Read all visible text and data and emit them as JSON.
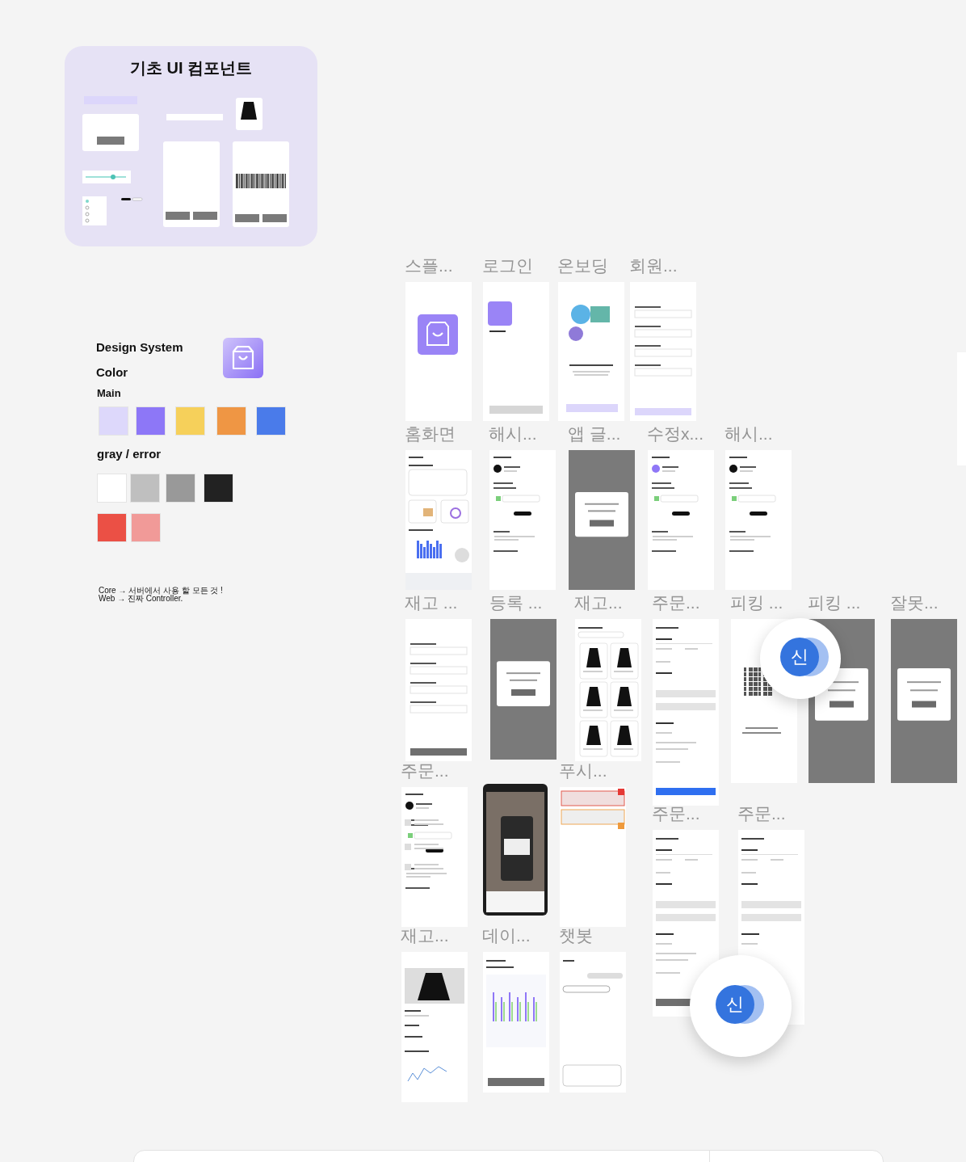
{
  "components_board": {
    "title": "기초 UI 컴포넌트"
  },
  "design_system": {
    "title": "Design System",
    "color_heading": "Color",
    "main_label": "Main",
    "main_colors": [
      {
        "color": "#ddd8fb"
      },
      {
        "color": "#8d77f7"
      },
      {
        "color": "#f6d05a"
      },
      {
        "color": "#ef9644"
      },
      {
        "color": "#4a7bea"
      }
    ],
    "gray_label": "gray / error",
    "gray_colors": [
      {
        "color": "#ffffff"
      },
      {
        "color": "#bfbfbf"
      },
      {
        "color": "#999999"
      },
      {
        "color": "#222222"
      }
    ],
    "error_colors": [
      {
        "color": "#eb5045"
      },
      {
        "color": "#f19a98"
      }
    ],
    "notes": [
      "Core → 서버에서 사용 할 모든 것 !",
      "Web → 진짜 Controller."
    ]
  },
  "frames": [
    {
      "title": "스플...",
      "kind": "splash"
    },
    {
      "title": "로그인",
      "kind": "login"
    },
    {
      "title": "온보딩",
      "kind": "onboarding"
    },
    {
      "title": "회원...",
      "kind": "form"
    },
    {
      "title": "홈화면",
      "kind": "home"
    },
    {
      "title": "해시...",
      "kind": "screen"
    },
    {
      "title": "앱 글...",
      "kind": "dark"
    },
    {
      "title": "수정x...",
      "kind": "screen"
    },
    {
      "title": "해시...",
      "kind": "screen"
    },
    {
      "title": "재고 ...",
      "kind": "form"
    },
    {
      "title": "등록 ...",
      "kind": "dark"
    },
    {
      "title": "재고...",
      "kind": "grid"
    },
    {
      "title": "주문...",
      "kind": "order"
    },
    {
      "title": "피킹 ...",
      "kind": "qr"
    },
    {
      "title": "피킹 ...",
      "kind": "dark"
    },
    {
      "title": "잘못...",
      "kind": "dark"
    },
    {
      "title": "주문...",
      "kind": "list"
    },
    {
      "kind": "phone"
    },
    {
      "title": "푸시...",
      "kind": "push"
    },
    {
      "title": "주문...",
      "kind": "order"
    },
    {
      "title": "주문...",
      "kind": "order"
    },
    {
      "title": "재고...",
      "kind": "product"
    },
    {
      "title": "데이...",
      "kind": "report"
    },
    {
      "title": "챗봇",
      "kind": "chat"
    }
  ],
  "avatars": [
    {
      "initial": "신"
    },
    {
      "initial": "신"
    }
  ]
}
